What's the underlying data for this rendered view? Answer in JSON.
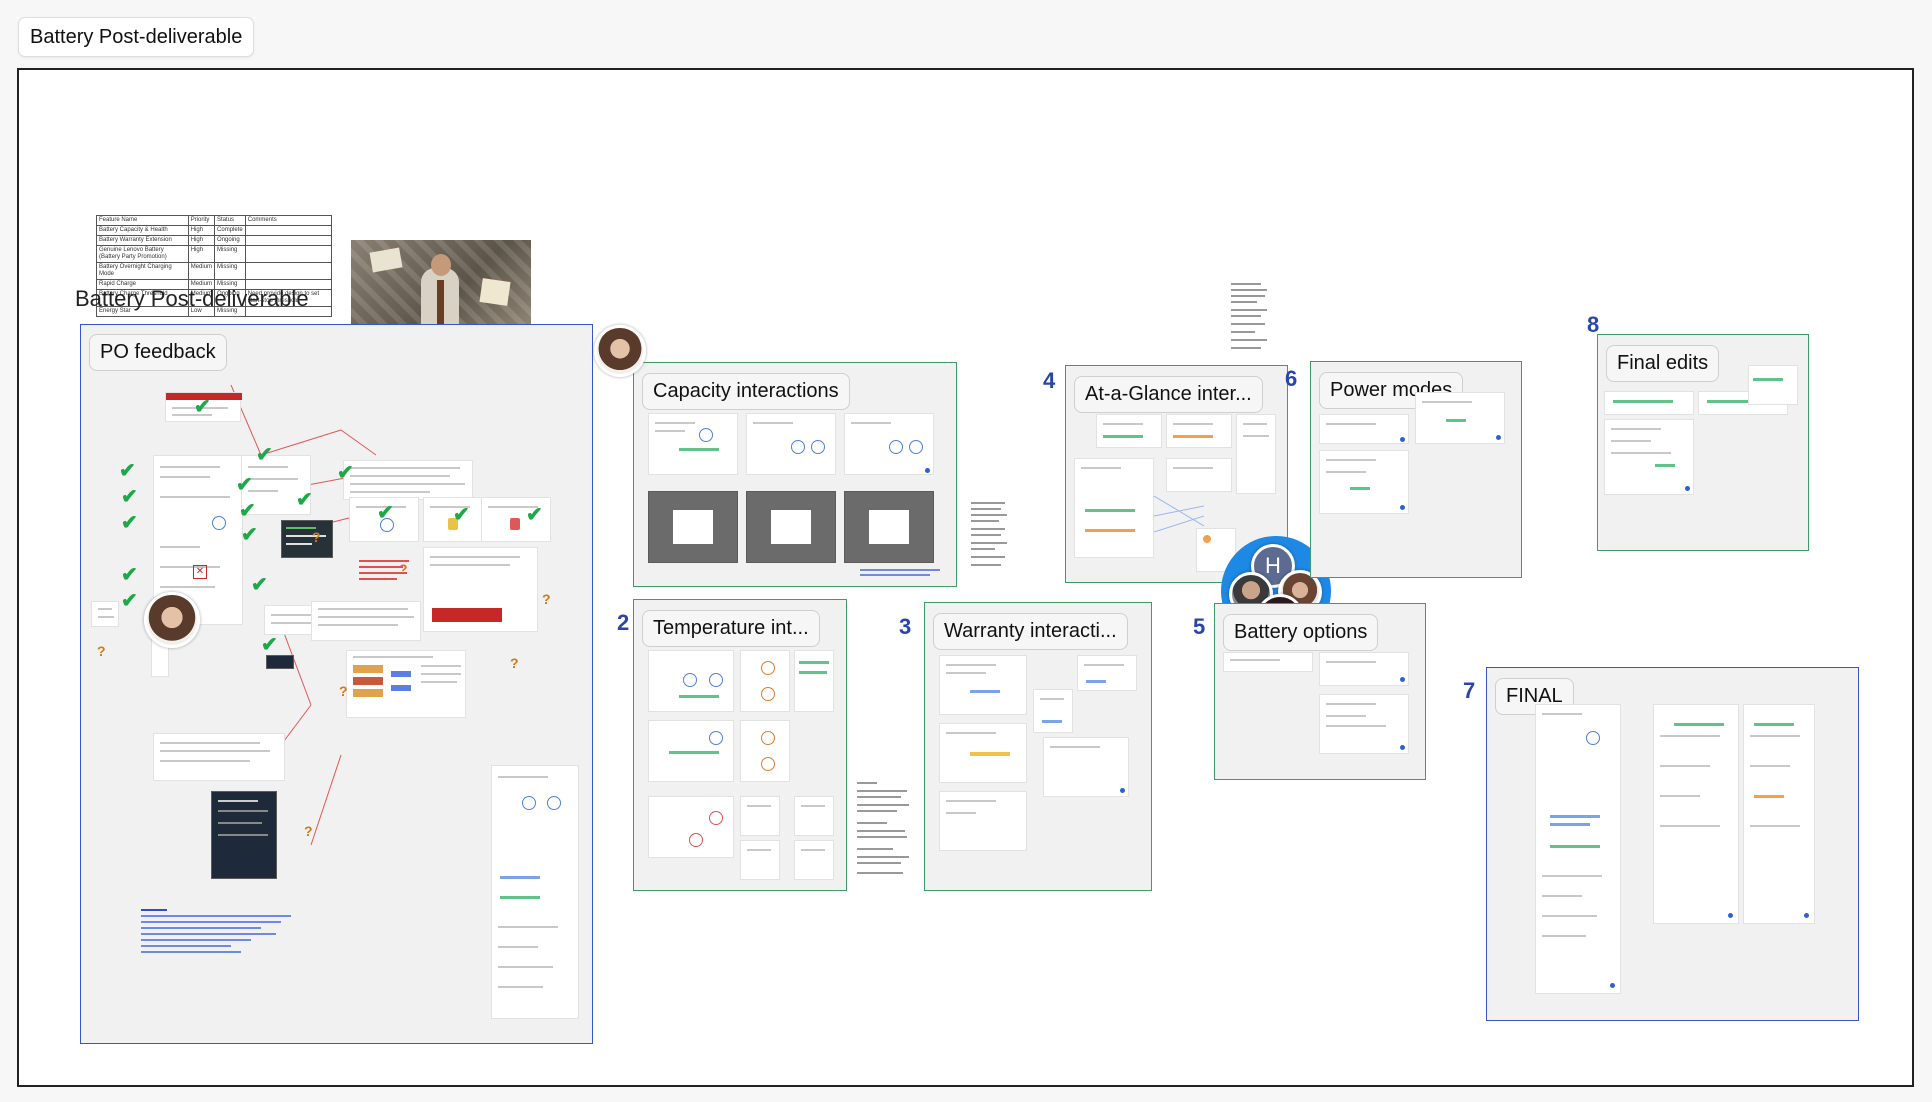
{
  "board": {
    "tab_title": "Battery Post-deliverable",
    "canvas_heading": "Battery Post-deliverable"
  },
  "feature_table": {
    "headers": [
      "Feature Name",
      "Priority",
      "Status",
      "Comments"
    ],
    "rows": [
      [
        "Battery Capacity & Health",
        "High",
        "Complete",
        ""
      ],
      [
        "Battery Warranty Extension",
        "High",
        "Ongoing",
        ""
      ],
      [
        "Genuine Lenovo Battery (Battery Party Promotion)",
        "High",
        "Missing",
        ""
      ],
      [
        "Battery Overnight Charging Mode",
        "Medium",
        "Missing",
        ""
      ],
      [
        "Rapid Charge",
        "Medium",
        "Missing",
        ""
      ],
      [
        "Battery Charge Threshold",
        "Medium",
        "Ongoing",
        "Need provide design to set start-stop threshold"
      ],
      [
        "Energy Star",
        "Low",
        "Missing",
        ""
      ]
    ]
  },
  "sections": {
    "po_feedback": {
      "title": "PO feedback"
    },
    "capacity": {
      "title": "Capacity interactions"
    },
    "temperature": {
      "number": "2",
      "title": "Temperature int..."
    },
    "warranty": {
      "number": "3",
      "title": "Warranty interacti..."
    },
    "at_a_glance": {
      "number": "4",
      "title": "At-a-Glance inter..."
    },
    "battery_options": {
      "number": "5",
      "title": "Battery options"
    },
    "power_modes": {
      "number": "6",
      "title": "Power modes"
    },
    "final": {
      "number": "7",
      "title": "FINAL"
    },
    "final_edits": {
      "number": "8",
      "title": "Final edits"
    }
  },
  "collaborators": {
    "initial": "H"
  },
  "colors": {
    "section_green": "#3a9d6a",
    "section_blue": "#3557c8",
    "number_blue": "#2746a7",
    "check_green": "#1fa84a",
    "question_orange": "#d07a1a",
    "presence_blue": "#1e88e5"
  }
}
